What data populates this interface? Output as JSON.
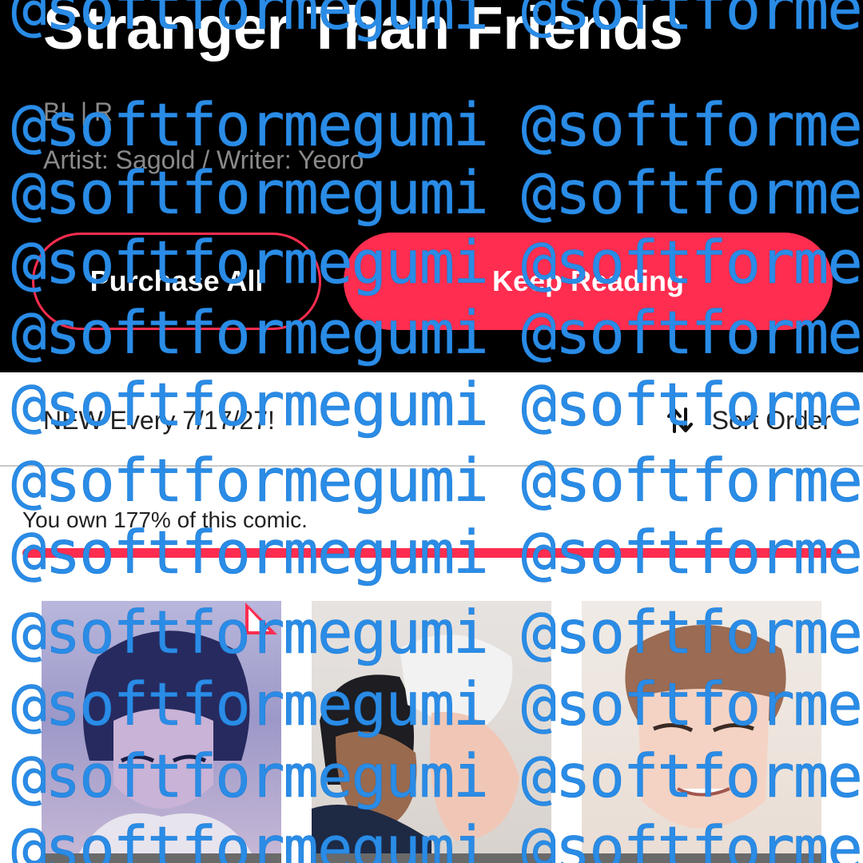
{
  "header": {
    "title": "Stranger Than Friends",
    "genre": "BL | R",
    "credits": "Artist: Sagold / Writer: Yeoro",
    "purchase_all_label": "Purchase All",
    "keep_reading_label": "Keep Reading"
  },
  "sort_bar": {
    "schedule": "NEW Every 7/17/27!",
    "sort_label": "Sort Order",
    "sort_icon": "sort-arrows-icon"
  },
  "ownership": {
    "text": "You own 177% of this comic.",
    "progress_percent": 100
  },
  "episodes": [
    {
      "thumbnail": "dark-haired-man-art",
      "badge": "corner-flag-icon"
    },
    {
      "thumbnail": "two-men-embrace-art"
    },
    {
      "thumbnail": "smiling-man-art"
    }
  ],
  "watermark": {
    "text": "@softformegumi @softformegumi"
  },
  "colors": {
    "accent": "#ff2d4f",
    "header_bg": "#000000",
    "watermark": "#2a8ce6",
    "muted_text": "#8a8a8a"
  }
}
